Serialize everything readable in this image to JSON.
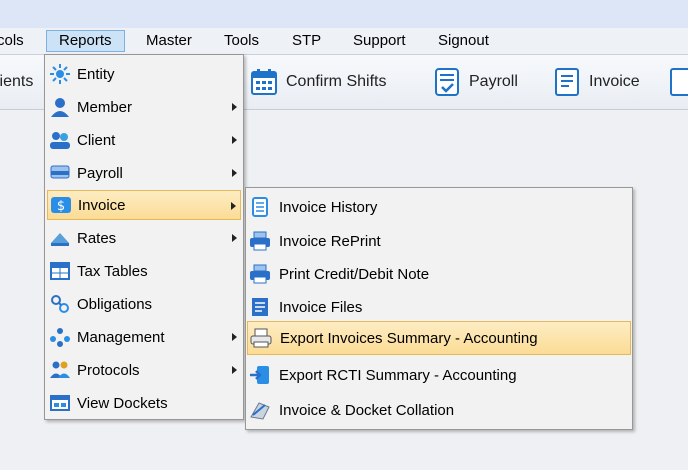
{
  "menubar": {
    "items": [
      {
        "label": "cols"
      },
      {
        "label": "Reports"
      },
      {
        "label": "Master"
      },
      {
        "label": "Tools"
      },
      {
        "label": "STP"
      },
      {
        "label": "Support"
      },
      {
        "label": "Signout"
      }
    ]
  },
  "toolbar": {
    "clients_label": "lients",
    "confirm_shifts_label": "Confirm Shifts",
    "payroll_label": "Payroll",
    "invoice_label": "Invoice"
  },
  "reports_menu": {
    "items": [
      {
        "label": "Entity",
        "icon": "entity-icon"
      },
      {
        "label": "Member",
        "icon": "member-icon"
      },
      {
        "label": "Client",
        "icon": "client-icon"
      },
      {
        "label": "Payroll",
        "icon": "payroll-icon"
      },
      {
        "label": "Invoice",
        "icon": "invoice-icon"
      },
      {
        "label": "Rates",
        "icon": "rates-icon"
      },
      {
        "label": "Tax Tables",
        "icon": "tax-tables-icon"
      },
      {
        "label": "Obligations",
        "icon": "obligations-icon"
      },
      {
        "label": "Management",
        "icon": "management-icon"
      },
      {
        "label": "Protocols",
        "icon": "protocols-icon"
      },
      {
        "label": "View Dockets",
        "icon": "view-dockets-icon"
      }
    ]
  },
  "invoice_submenu": {
    "items": [
      {
        "label": "Invoice History",
        "icon": "invoice-history-icon"
      },
      {
        "label": "Invoice RePrint",
        "icon": "printer-icon"
      },
      {
        "label": "Print Credit/Debit Note",
        "icon": "printer-icon"
      },
      {
        "label": "Invoice Files",
        "icon": "invoice-files-icon"
      },
      {
        "label": "Export Invoices Summary - Accounting",
        "icon": "export-printer-icon"
      },
      {
        "label": "Export RCTI Summary - Accounting",
        "icon": "export-arrow-icon"
      },
      {
        "label": "Invoice & Docket Collation",
        "icon": "collation-icon"
      }
    ]
  },
  "colors": {
    "highlight_top": "#fdecc3",
    "highlight_bottom": "#fbdc95",
    "highlight_border": "#e7b956",
    "menu_active": "#cce3f7"
  }
}
